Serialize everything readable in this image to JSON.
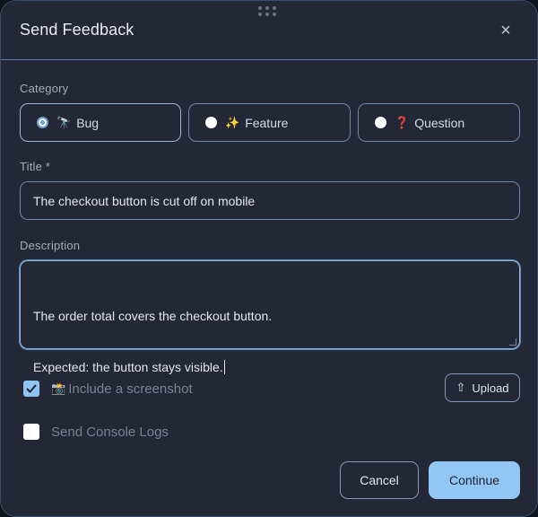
{
  "dialog": {
    "title": "Send Feedback",
    "close_glyph": "×"
  },
  "category": {
    "label": "Category",
    "options": [
      {
        "icon": "🔭",
        "icon_name": "telescope-icon",
        "label": "Bug",
        "selected": true
      },
      {
        "icon": "✨",
        "icon_name": "sparkles-icon",
        "label": "Feature",
        "selected": false
      },
      {
        "icon": "❓",
        "icon_name": "question-icon",
        "label": "Question",
        "selected": false
      }
    ]
  },
  "title_field": {
    "label": "Title *",
    "value": "The checkout button is cut off on mobile"
  },
  "description_field": {
    "label": "Description",
    "line1": "The order total covers the checkout button.",
    "line2": "Expected: the button stays visible."
  },
  "options": {
    "screenshot_icon": "📸",
    "screenshot_label": "Include a screenshot",
    "screenshot_checked": true,
    "console_label": "Send Console Logs",
    "console_checked": false
  },
  "upload": {
    "icon": "⇧",
    "label": "Upload"
  },
  "footer": {
    "cancel_label": "Cancel",
    "continue_label": "Continue"
  },
  "colors": {
    "background": "#232736",
    "accent": "#92c6f4",
    "border": "#6f87a8"
  }
}
